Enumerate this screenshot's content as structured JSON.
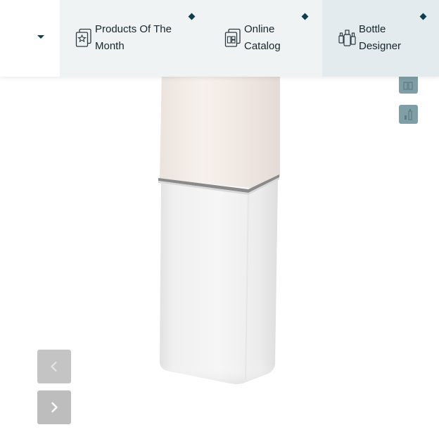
{
  "nav": {
    "items": [
      {
        "label": "Products Of The Month",
        "icon": "product-star-icon"
      },
      {
        "label": "Online Catalog",
        "icon": "catalog-icon"
      },
      {
        "label": "Bottle Designer",
        "icon": "bottles-icon"
      }
    ]
  },
  "gallery": {
    "thumbnails": [
      "bottle-thumb-icon",
      "bottle-thumb-icon"
    ],
    "controls": {
      "prev": "chevron-left-icon",
      "next": "chevron-right-icon"
    }
  },
  "colors": {
    "accent": "#0f3d4c",
    "nav_bg": "#eff3f4",
    "nav_active_bg": "#e3ebee",
    "thumb_bg": "#7f9ea5",
    "arrow_bg": "#bdbdbd"
  }
}
